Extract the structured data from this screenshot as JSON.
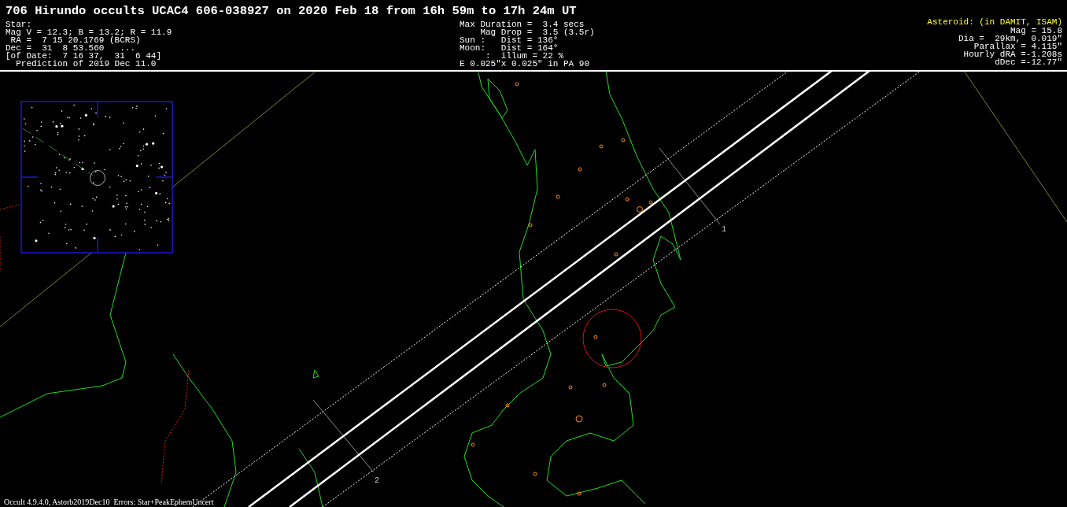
{
  "title": "706 Hirundo occults UCAC4 606-038927 on 2020 Feb 18 from 16h 59m to 17h 24m UT",
  "star": [
    "Star:",
    "Mag V = 12.3; B = 13.2; R = 11.9",
    " RA =  7 15 20.1769 (BCRS)",
    "Dec =  31  8 53.560   ...",
    "[of Date:  7 16 37,  31  6 44]",
    "  Prediction of 2019 Dec 11.0"
  ],
  "event": [
    "Max Duration =  3.4 secs",
    "    Mag Drop =  3.5 (3.5r)",
    "Sun :   Dist = 136°",
    "Moon:   Dist = 164°",
    "     :  illum = 22 %",
    "E 0.025\"x 0.025\" in PA 90"
  ],
  "asteroid": {
    "heading": "Asteroid: (in DAMIT, ISAM)",
    "lines": [
      "Mag = 15.8",
      "Dia =  29km,  0.019\"",
      "Parallax = 4.115\"",
      "Hourly dRA =-1.208s",
      "dDec =-12.77\""
    ]
  },
  "path_labels": [
    "1",
    "2"
  ],
  "footer": "Occult 4.9.4.0, Astorb2019Dec10  Errors: Star+PeakEphemUncert"
}
